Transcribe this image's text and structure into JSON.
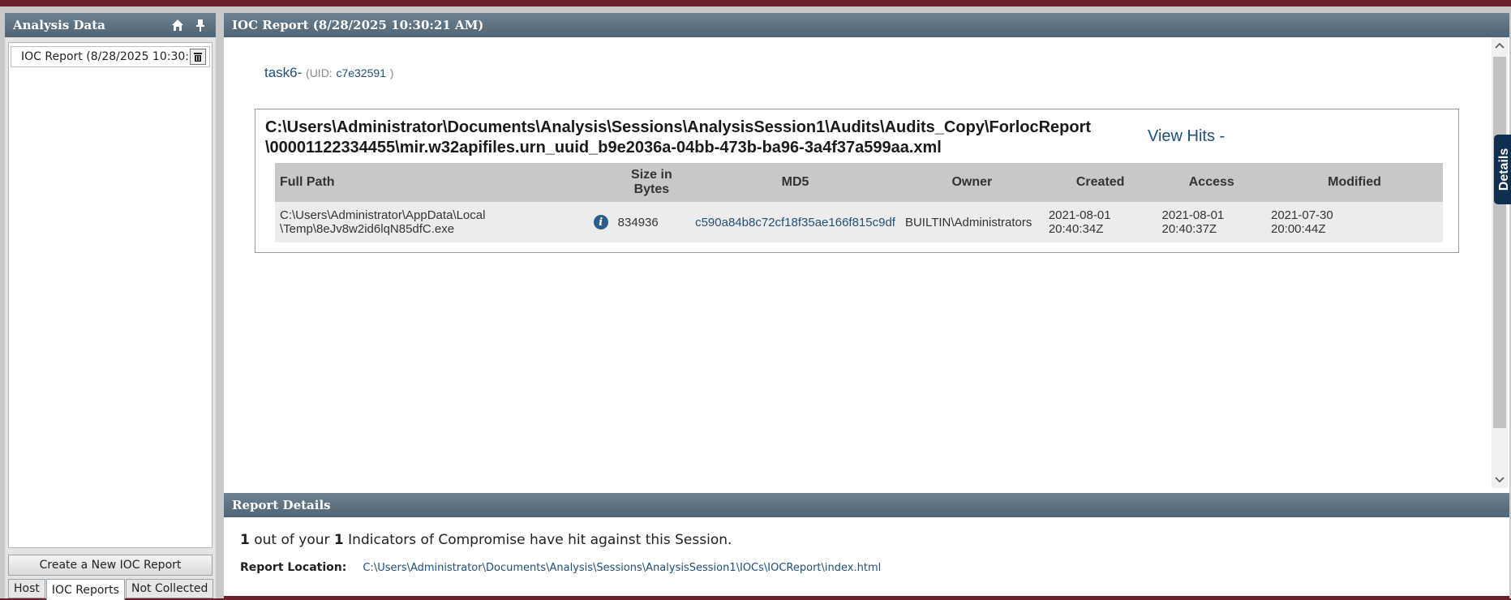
{
  "left_panel": {
    "title": "Analysis Data",
    "items": [
      {
        "label": "IOC Report (8/28/2025 10:30:2"
      }
    ],
    "create_button": "Create a New IOC Report",
    "tabs": [
      "Host",
      "IOC Reports",
      "Not Collected"
    ],
    "active_tab": "IOC Reports"
  },
  "report": {
    "title": "IOC Report (8/28/2025 10:30:21 AM)",
    "task": "task6-",
    "uid_label": "(UID:",
    "uid_value": "c7e32591",
    "uid_close": ")",
    "path_line1": "C:\\Users\\Administrator\\Documents\\Analysis\\Sessions\\AnalysisSession1\\Audits\\Audits_Copy\\ForlocReport",
    "path_line2": "\\00001122334455\\mir.w32apifiles.urn_uuid_b9e2036a-04bb-473b-ba96-3a4f37a599aa.xml",
    "view_hits": "View Hits -",
    "table": {
      "headers": {
        "full_path": "Full Path",
        "size_1": "Size in",
        "size_2": "Bytes",
        "md5": "MD5",
        "owner": "Owner",
        "created": "Created",
        "access": "Access",
        "modified": "Modified"
      },
      "rows": [
        {
          "path_1": "C:\\Users\\Administrator\\AppData\\Local",
          "path_2": "\\Temp\\8eJv8w2id6lqN85dfC.exe",
          "size": "834936",
          "md5": "c590a84b8c72cf18f35ae166f815c9df",
          "owner": "BUILTIN\\Administrators",
          "created_date": "2021-08-01",
          "created_time": "20:40:34Z",
          "access_date": "2021-08-01",
          "access_time": "20:40:37Z",
          "modified_date": "2021-07-30",
          "modified_time": "20:00:44Z"
        }
      ]
    },
    "details_tab": "Details"
  },
  "report_details": {
    "title": "Report Details",
    "hits": "1",
    "mid_text": " out of your ",
    "total": "1",
    "end_text": " Indicators of Compromise have hit against this Session.",
    "location_label": "Report Location:",
    "location_value": "C:\\Users\\Administrator\\Documents\\Analysis\\Sessions\\AnalysisSession1\\IOCs\\IOCReport\\index.html"
  },
  "icons": {
    "home": "home-icon",
    "pin": "pin-icon",
    "trash": "trash-icon",
    "info": "info-icon",
    "scroll_up": "chevron-up-icon",
    "scroll_down": "chevron-down-icon"
  }
}
